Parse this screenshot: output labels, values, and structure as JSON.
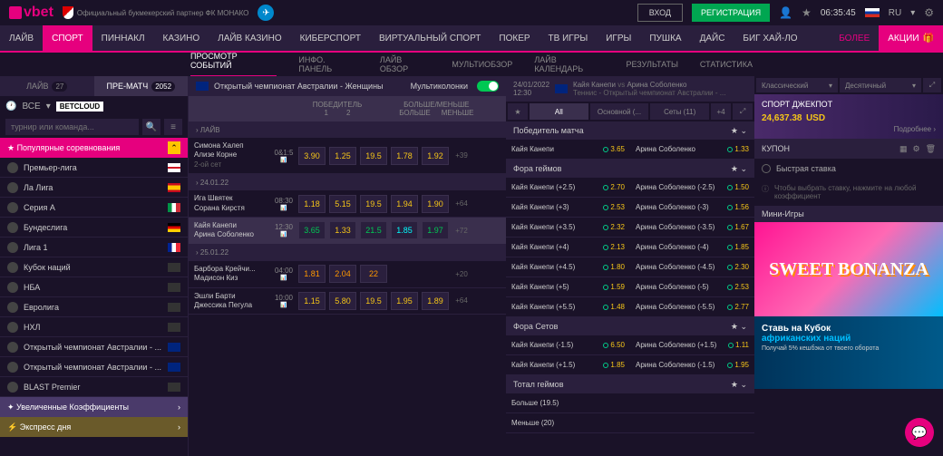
{
  "header": {
    "logo": "vbet",
    "partner": "Официальный букмекерский партнер ФК МОНАКО",
    "login": "ВХОД",
    "register": "РЕГИСТРАЦИЯ",
    "time": "06:35:45",
    "lang": "RU"
  },
  "nav": [
    "ЛАЙВ",
    "СПОРТ",
    "ПИННАКЛ",
    "КАЗИНО",
    "ЛАЙВ КАЗИНО",
    "КИБЕРСПОРТ",
    "ВИРТУАЛЬНЫЙ СПОРТ",
    "ПОКЕР",
    "ТВ ИГРЫ",
    "ИГРЫ",
    "ПУШКА",
    "ДАЙС",
    "БИГ ХАЙ-ЛО"
  ],
  "nav_more": "БОЛЕЕ",
  "nav_promo": "АКЦИИ",
  "subnav": [
    "ПРОСМОТР СОБЫТИЙ",
    "ИНФО. ПАНЕЛЬ",
    "ЛАЙВ ОБЗОР",
    "МУЛЬТИОБЗОР",
    "ЛАЙВ КАЛЕНДАРЬ",
    "РЕЗУЛЬТАТЫ",
    "СТАТИСТИКА"
  ],
  "sidebar": {
    "tab_live": "ЛАЙВ",
    "tab_live_n": "27",
    "tab_pre": "ПРЕ-МАТЧ",
    "tab_pre_n": "2052",
    "all": "ВСЕ",
    "betcloud": "BETCLOUD",
    "search": "турнир или команда...",
    "popular": "Популярные соревнования",
    "leagues": [
      "Премьер-лига",
      "Ла Лига",
      "Серия А",
      "Бундеслига",
      "Лига 1",
      "Кубок наций",
      "НБА",
      "Евролига",
      "НХЛ",
      "Открытый чемпионат Австралии - ...",
      "Открытый чемпионат Австралии - ...",
      "BLAST Premier"
    ],
    "boost1": "Увеличенные Коэффициенты",
    "boost2": "Экспресс дня"
  },
  "center": {
    "event_title": "Открытый чемпионат Австралии - Женщины",
    "multi": "Мультиколонки",
    "mkt1": "ПОБЕДИТЕЛЬ",
    "mkt1a": "1",
    "mkt1b": "2",
    "mkt2": "БОЛЬШЕ/МЕНЬШЕ",
    "mkt2a": "БОЛЬШЕ",
    "mkt2b": "МЕНЬШЕ",
    "sec_live": "› ЛАЙВ",
    "sec_d1": "› 24.01.22",
    "sec_d2": "› 25.01.22",
    "matches": [
      {
        "t1": "Симона Халеп",
        "t2": "Ализе Корне",
        "t3": "2-ой сет",
        "tm": "0&1:5",
        "o": [
          "3.90",
          "1.25",
          "19.5",
          "1.78",
          "1.92"
        ],
        "p": "+39"
      },
      {
        "t1": "Ига Швятек",
        "t2": "Сорана Кирстя",
        "tm": "08:30",
        "o": [
          "1.18",
          "5.15",
          "19.5",
          "1.94",
          "1.90"
        ],
        "p": "+64"
      },
      {
        "t1": "Кайя Канепи",
        "t2": "Арина Соболенко",
        "tm": "12:30",
        "o": [
          "3.65",
          "1.33",
          "21.5",
          "1.85",
          "1.97"
        ],
        "p": "+72",
        "hl": true,
        "g": true
      },
      {
        "t1": "Барбора Крейчи...",
        "t2": "Мадисон Киз",
        "tm": "04:00",
        "o": [
          "1.81",
          "2.04",
          "22",
          "",
          ""
        ],
        "p": "+20"
      },
      {
        "t1": "Эшли Барти",
        "t2": "Джессика Пегула",
        "tm": "10:00",
        "o": [
          "1.15",
          "5.80",
          "19.5",
          "1.95",
          "1.89"
        ],
        "p": "+64"
      }
    ]
  },
  "detail": {
    "date": "24/01/2022",
    "time": "12:30",
    "p1": "Кайя Канепи",
    "vs": "vs",
    "p2": "Арина Соболенко",
    "comp": "Теннис - Открытый чемпионат Австралии - ...",
    "tabs": [
      "All",
      "Основной (...",
      "Сеты (11)",
      "+4"
    ],
    "sec_winner": "Победитель матча",
    "winner": {
      "n1": "Кайя Канепи",
      "o1": "3.65",
      "n2": "Арина Соболенко",
      "o2": "1.33"
    },
    "sec_gh": "Фора геймов",
    "gh": [
      {
        "n1": "Кайя Канепи (+2.5)",
        "o1": "2.70",
        "n2": "Арина Соболенко (-2.5)",
        "o2": "1.50"
      },
      {
        "n1": "Кайя Канепи (+3)",
        "o1": "2.53",
        "n2": "Арина Соболенко (-3)",
        "o2": "1.56"
      },
      {
        "n1": "Кайя Канепи (+3.5)",
        "o1": "2.32",
        "n2": "Арина Соболенко (-3.5)",
        "o2": "1.67"
      },
      {
        "n1": "Кайя Канепи (+4)",
        "o1": "2.13",
        "n2": "Арина Соболенко (-4)",
        "o2": "1.85"
      },
      {
        "n1": "Кайя Канепи (+4.5)",
        "o1": "1.80",
        "n2": "Арина Соболенко (-4.5)",
        "o2": "2.30"
      },
      {
        "n1": "Кайя Канепи (+5)",
        "o1": "1.59",
        "n2": "Арина Соболенко (-5)",
        "o2": "2.53"
      },
      {
        "n1": "Кайя Канепи (+5.5)",
        "o1": "1.48",
        "n2": "Арина Соболенко (-5.5)",
        "o2": "2.77"
      }
    ],
    "sec_sh": "Фора Сетов",
    "sh": [
      {
        "n1": "Кайя Канепи (-1.5)",
        "o1": "6.50",
        "n2": "Арина Соболенко (+1.5)",
        "o2": "1.11"
      },
      {
        "n1": "Кайя Канепи (+1.5)",
        "o1": "1.85",
        "n2": "Арина Соболенко (-1.5)",
        "o2": "1.95"
      }
    ],
    "sec_tg": "Тотал геймов",
    "tg": [
      {
        "n": "Больше (19.5)"
      },
      {
        "n": "Меньше (20)"
      }
    ]
  },
  "right": {
    "view1": "Классический",
    "view2": "Десятичный",
    "jp_title": "СПОРТ ДЖЕКПОТ",
    "jp_amt": "24,637.38",
    "jp_cur": "USD",
    "jp_more": "Подробнее ›",
    "coupon": "КУПОН",
    "quickbet": "Быстрая ставка",
    "hint": "Чтобы выбрать ставку, нажмите на любой коэффициент",
    "mini": "Мини-Игры",
    "game": "SWEET BONANZA",
    "promo1": "Ставь на Кубок",
    "promo2": "африканских наций",
    "promo3": "Получай 5% кешбэка от твоего оборота"
  }
}
